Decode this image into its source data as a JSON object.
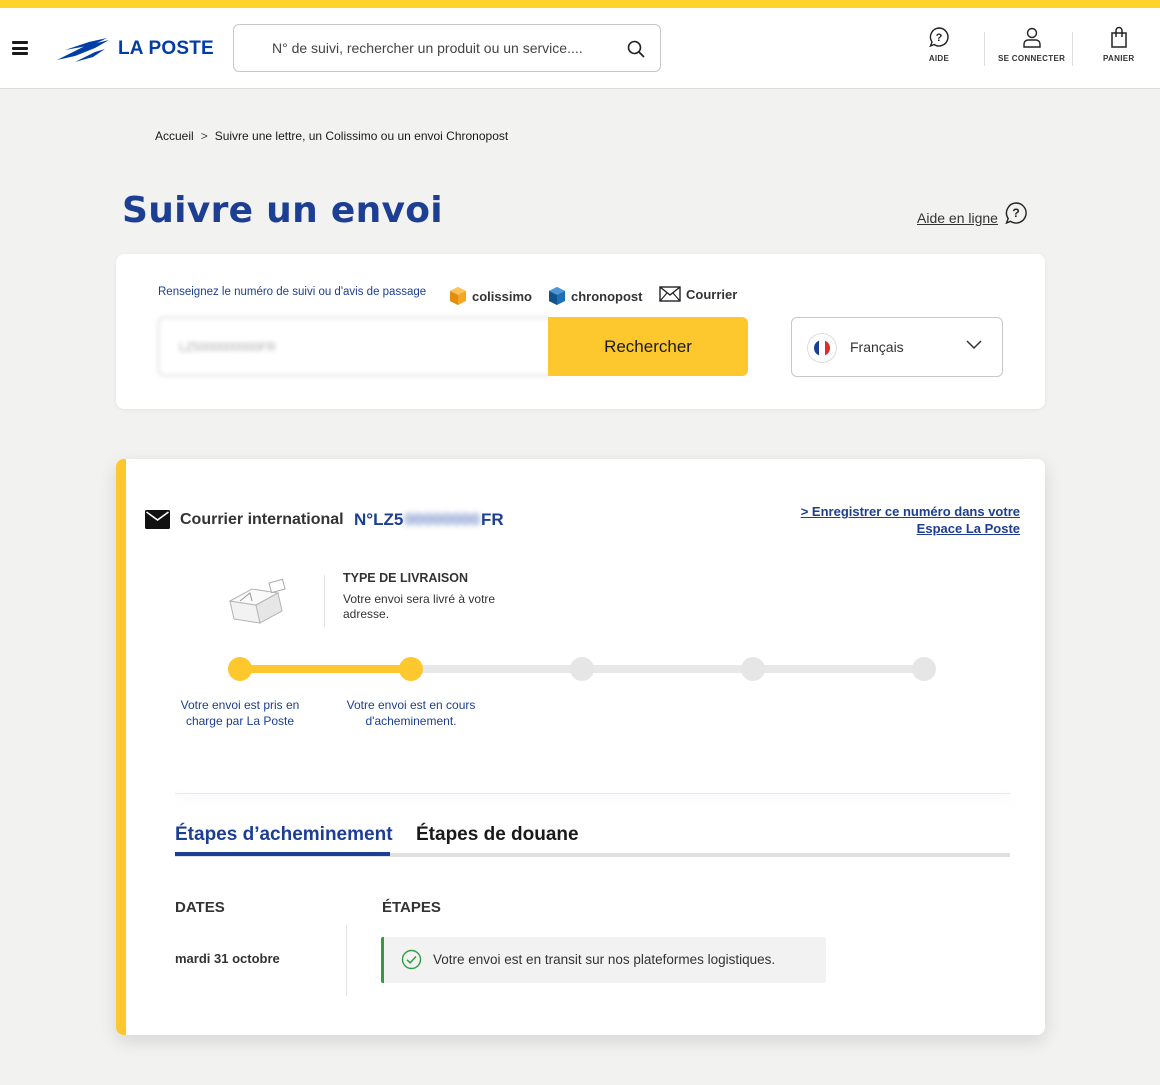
{
  "header": {
    "logo_text": "LA POSTE",
    "search_placeholder": "N° de suivi, rechercher un produit ou un service....",
    "help_label": "AIDE",
    "login_label": "SE CONNECTER",
    "cart_label": "PANIER"
  },
  "breadcrumb": [
    "Accueil",
    "Suivre une lettre, un Colissimo ou un envoi Chronopost"
  ],
  "page": {
    "title": "Suivre un envoi",
    "help_link": "Aide en ligne"
  },
  "search_card": {
    "hint": "Renseignez le numéro de suivi ou d'avis de passage",
    "brands": [
      "colissimo",
      "chronopost",
      "Courrier"
    ],
    "tracking_value": "LZ5000000000FR",
    "search_button": "Rechercher",
    "language": "Français"
  },
  "result": {
    "shipment_type": "Courrier international",
    "tracking_prefix": "N°LZ5",
    "tracking_hidden": "00000000",
    "tracking_suffix": "FR",
    "save_link": "> Enregistrer ce numéro dans votre Espace La Poste",
    "delivery_type_title": "TYPE DE LIVRAISON",
    "delivery_type_desc": "Votre envoi sera livré à votre adresse.",
    "progress": {
      "steps_total": 5,
      "steps_done": 2,
      "labels": [
        "Votre envoi est pris en charge par La Poste",
        "Votre envoi est en cours d'acheminement."
      ]
    },
    "tabs": [
      "Étapes d’acheminement",
      "Étapes de douane"
    ],
    "active_tab": 0,
    "columns": [
      "DATES",
      "ÉTAPES"
    ],
    "events": [
      {
        "date": "mardi 31 octobre",
        "text": "Votre envoi est en transit sur nos plateformes logistiques."
      }
    ]
  },
  "colors": {
    "accent_yellow": "#fcc82d",
    "brand_blue": "#1c3e93",
    "success_green": "#2e9e3e"
  }
}
